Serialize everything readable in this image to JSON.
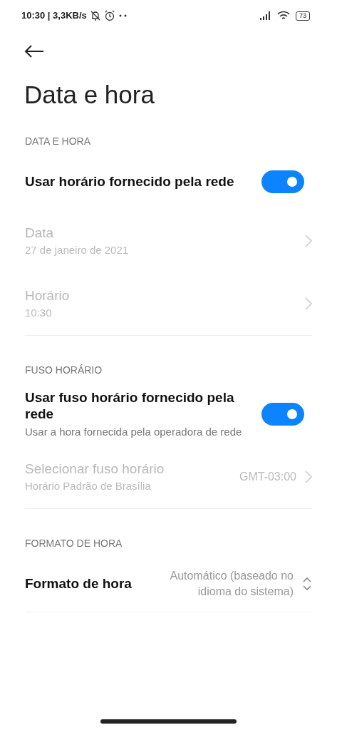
{
  "status_bar": {
    "left_text": "10:30 | 3,3KB/s",
    "battery": "73"
  },
  "title": "Data e hora",
  "sections": [
    {
      "header": "DATA E HORA",
      "items": [
        {
          "kind": "toggle",
          "label": "Usar horário fornecido pela rede",
          "on": true,
          "disabled": false
        },
        {
          "kind": "link",
          "label": "Data",
          "subtitle": "27 de janeiro de 2021",
          "disabled": true
        },
        {
          "kind": "link",
          "label": "Horário",
          "subtitle": "10:30",
          "disabled": true
        }
      ]
    },
    {
      "header": "FUSO HORÁRIO",
      "items": [
        {
          "kind": "toggle",
          "label": "Usar fuso horário fornecido pela rede",
          "subtitle": "Usar a hora fornecida pela operadora de rede",
          "on": true,
          "disabled": false
        },
        {
          "kind": "link",
          "label": "Selecionar fuso horário",
          "subtitle": "Horário Padrão de Brasília",
          "value": "GMT-03:00",
          "disabled": true
        }
      ]
    },
    {
      "header": "FORMATO DE HORA",
      "items": [
        {
          "kind": "dropdown",
          "label": "Formato de hora",
          "value": "Automático (baseado no idioma do sistema)",
          "disabled": false
        }
      ]
    }
  ]
}
